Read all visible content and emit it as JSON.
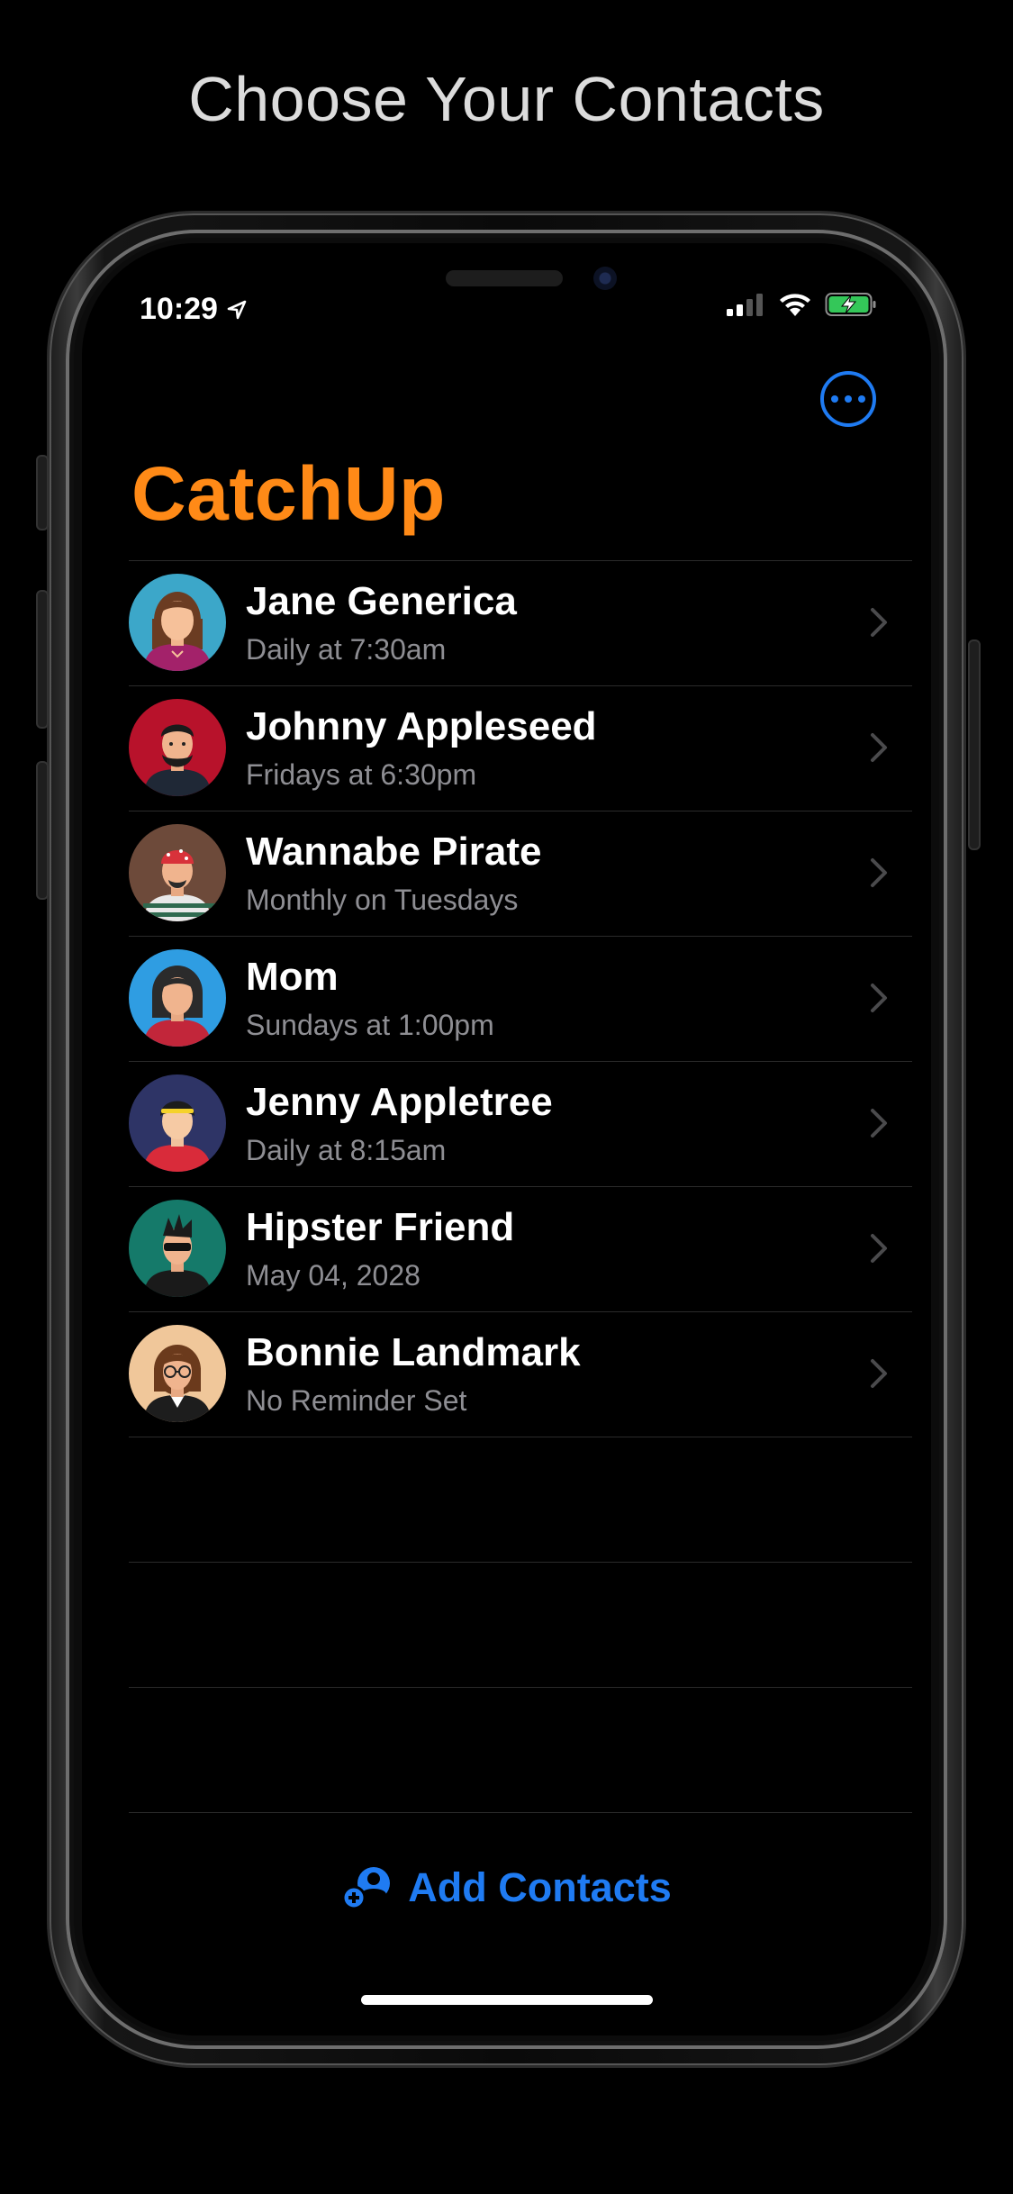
{
  "headline": "Choose Your Contacts",
  "status_bar": {
    "time": "10:29"
  },
  "app": {
    "title": "CatchUp",
    "more_icon": "ellipsis-circle-icon",
    "accent_color": "#ff8a17",
    "tint_color": "#1f7bf2"
  },
  "contacts": [
    {
      "name": "Jane Generica",
      "reminder": "Daily at 7:30am"
    },
    {
      "name": "Johnny Appleseed",
      "reminder": "Fridays at 6:30pm"
    },
    {
      "name": "Wannabe Pirate",
      "reminder": "Monthly on Tuesdays"
    },
    {
      "name": "Mom",
      "reminder": "Sundays at 1:00pm"
    },
    {
      "name": "Jenny Appletree",
      "reminder": "Daily at 8:15am"
    },
    {
      "name": "Hipster Friend",
      "reminder": "May 04, 2028"
    },
    {
      "name": "Bonnie Landmark",
      "reminder": "No Reminder Set"
    }
  ],
  "add_contacts": {
    "label": "Add Contacts",
    "icon": "add-person-icon"
  }
}
